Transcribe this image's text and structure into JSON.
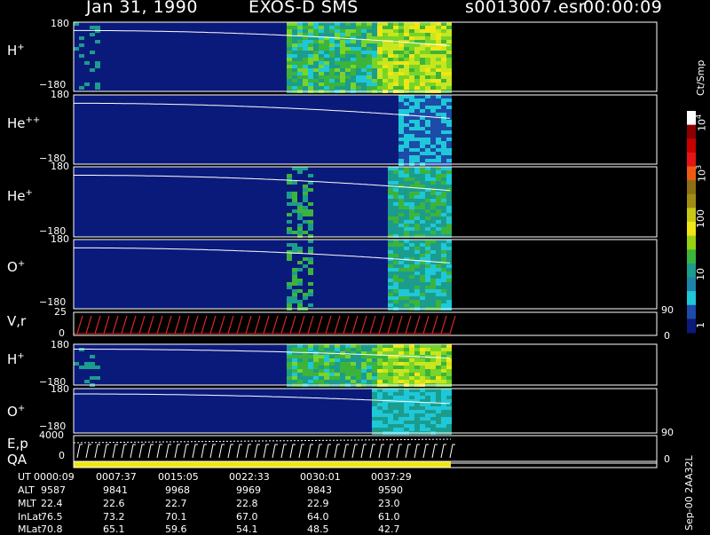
{
  "header": {
    "date": "Jan 31, 1990",
    "mission": "EXOS-D SMS",
    "file": "s0013007.esr",
    "time": "00:00:09"
  },
  "colorbar": {
    "label": "Ct/Smp",
    "ticks": [
      "1",
      "10",
      "100",
      "10",
      "10"
    ],
    "tick_exp": [
      "",
      "",
      "",
      "3",
      "4"
    ]
  },
  "footer_id": "Sep-00 2AA32L",
  "panels": [
    {
      "label": "H",
      "sup": "+",
      "ymax": "180",
      "ymin": "−180"
    },
    {
      "label": "He",
      "sup": "++",
      "ymax": "180",
      "ymin": "−180"
    },
    {
      "label": "He",
      "sup": "+",
      "ymax": "180",
      "ymin": "−180"
    },
    {
      "label": "O",
      "sup": "+",
      "ymax": "180",
      "ymin": "−180"
    },
    {
      "label": "V,r",
      "sup": "",
      "ymax": "25",
      "ymin": "0",
      "rmax": "90",
      "rmin": "0"
    },
    {
      "label": "H",
      "sup": "+",
      "ymax": "180",
      "ymin": "−180"
    },
    {
      "label": "O",
      "sup": "+",
      "ymax": "180",
      "ymin": "−180"
    },
    {
      "label": "E,p",
      "sup": "",
      "ymax": "4000",
      "ymin": "0",
      "rmax": "90",
      "rmin": "0"
    },
    {
      "label": "QA",
      "sup": "",
      "ymax": "",
      "ymin": ""
    }
  ],
  "ephemeris": {
    "labels": [
      "UT",
      "ALT",
      "MLT",
      "InLat",
      "MLat"
    ],
    "columns": [
      [
        "0000:09",
        "9587",
        "22.4",
        "76.5",
        "70.8"
      ],
      [
        "0007:37",
        "9841",
        "22.6",
        "73.2",
        "65.1"
      ],
      [
        "0015:05",
        "9968",
        "22.7",
        "70.1",
        "59.6"
      ],
      [
        "0022:33",
        "9969",
        "22.8",
        "67.0",
        "54.1"
      ],
      [
        "0030:01",
        "9843",
        "22.9",
        "64.0",
        "48.5"
      ],
      [
        "0037:29",
        "9590",
        "23.0",
        "61.0",
        "42.7"
      ]
    ]
  },
  "chart_data": {
    "type": "heatmap",
    "x_unit": "UT",
    "ylim": [
      -180,
      180
    ],
    "colorbar_range": [
      1,
      10000
    ],
    "colorbar_scale": "log",
    "data_coverage_ut_end": "0040:00",
    "colors": {
      "background": "#000000",
      "low": "#0a1a7a",
      "cyan": "#1ec8d8",
      "green": "#3cb43c",
      "yellow": "#f0e614",
      "orange": "#f08c14",
      "red": "#e61414",
      "trace": "#e02828"
    }
  }
}
